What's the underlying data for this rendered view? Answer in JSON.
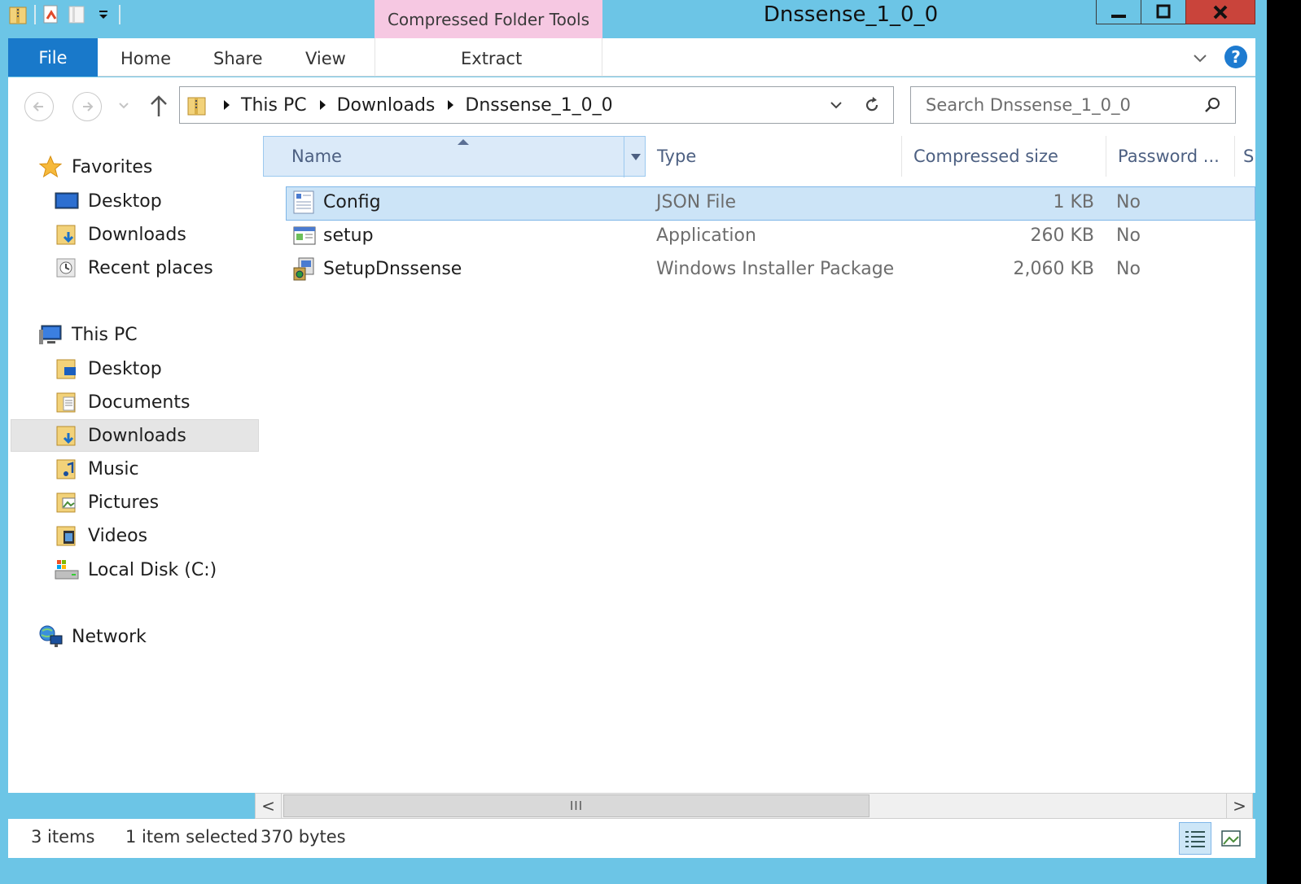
{
  "window": {
    "title": "Dnssense_1_0_0",
    "context_group": "Compressed Folder Tools"
  },
  "ribbon": {
    "file": "File",
    "tabs": [
      "Home",
      "Share",
      "View"
    ],
    "context_tab": "Extract",
    "help": "?"
  },
  "address": {
    "crumbs": [
      "This PC",
      "Downloads",
      "Dnssense_1_0_0"
    ],
    "search_placeholder": "Search Dnssense_1_0_0"
  },
  "nav": {
    "favorites": {
      "label": "Favorites",
      "items": [
        "Desktop",
        "Downloads",
        "Recent places"
      ]
    },
    "this_pc": {
      "label": "This PC",
      "items": [
        "Desktop",
        "Documents",
        "Downloads",
        "Music",
        "Pictures",
        "Videos",
        "Local Disk (C:)"
      ]
    },
    "network": {
      "label": "Network"
    },
    "selected": "Downloads"
  },
  "columns": {
    "name": "Name",
    "type": "Type",
    "compressed_size": "Compressed size",
    "password": "Password ...",
    "more": "S"
  },
  "files": [
    {
      "name": "Config",
      "type": "JSON File",
      "size": "1 KB",
      "password": "No",
      "icon": "json-file-icon",
      "selected": true
    },
    {
      "name": "setup",
      "type": "Application",
      "size": "260 KB",
      "password": "No",
      "icon": "application-icon",
      "selected": false
    },
    {
      "name": "SetupDnssense",
      "type": "Windows Installer Package",
      "size": "2,060 KB",
      "password": "No",
      "icon": "installer-package-icon",
      "selected": false
    }
  ],
  "scroll": {
    "left": "<",
    "right": ">",
    "thumb": "III"
  },
  "status": {
    "items": "3 items",
    "selected": "1 item selected",
    "bytes": "370 bytes"
  },
  "colors": {
    "title_bar": "#6cc5e6",
    "file_tab": "#1979ca",
    "context_tab": "#f6c8e2",
    "selection": "#cce4f7",
    "close_button": "#c9443b"
  }
}
